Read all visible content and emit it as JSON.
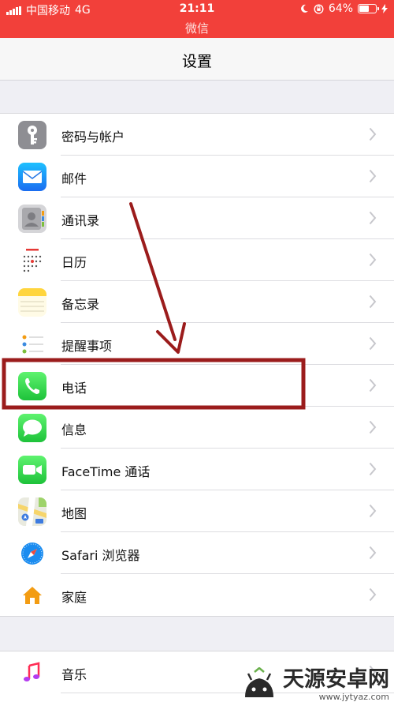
{
  "status_bar": {
    "carrier": "中国移动",
    "network": "4G",
    "time": "21:11",
    "battery_percent": "64%",
    "battery_level": 0.64,
    "return_app": "微信",
    "bg_color": "#f2403a"
  },
  "nav": {
    "title": "设置"
  },
  "settings_group1": [
    {
      "label": "密码与帐户",
      "icon": "key-icon"
    },
    {
      "label": "邮件",
      "icon": "mail-icon"
    },
    {
      "label": "通讯录",
      "icon": "contacts-icon"
    },
    {
      "label": "日历",
      "icon": "calendar-icon"
    },
    {
      "label": "备忘录",
      "icon": "notes-icon"
    },
    {
      "label": "提醒事项",
      "icon": "reminders-icon"
    },
    {
      "label": "电话",
      "icon": "phone-icon",
      "highlighted": true
    },
    {
      "label": "信息",
      "icon": "messages-icon"
    },
    {
      "label": "FaceTime 通话",
      "icon": "facetime-icon"
    },
    {
      "label": "地图",
      "icon": "maps-icon"
    },
    {
      "label": "Safari 浏览器",
      "icon": "safari-icon"
    },
    {
      "label": "家庭",
      "icon": "home-icon"
    }
  ],
  "settings_group2": [
    {
      "label": "音乐",
      "icon": "music-icon"
    }
  ],
  "annotation": {
    "color": "#9b1c1c"
  },
  "watermark": {
    "text": "天源安卓网",
    "url": "www.jytyaz.com"
  }
}
